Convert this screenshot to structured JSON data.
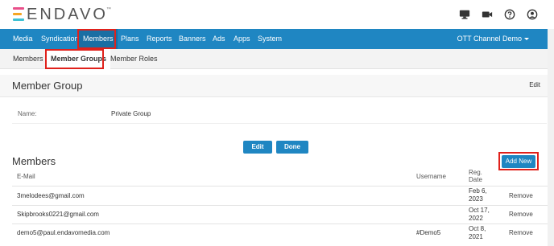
{
  "brand": {
    "name": "ENDAVO",
    "tm": "™"
  },
  "header_icons": [
    "monitor-icon",
    "video-camera-icon",
    "help-icon",
    "user-account-icon"
  ],
  "nav": {
    "items": [
      "Media",
      "Syndication",
      "Members",
      "Plans",
      "Reports",
      "Banners",
      "Ads",
      "Apps",
      "System"
    ],
    "active": "Members",
    "channel": "OTT Channel Demo"
  },
  "subnav": {
    "items": [
      "Members",
      "Member Groups",
      "Member Roles"
    ],
    "active": "Member Groups"
  },
  "group": {
    "title": "Member Group",
    "edit_label": "Edit",
    "name_label": "Name:",
    "name_value": "Private Group",
    "edit_button": "Edit",
    "done_button": "Done"
  },
  "members": {
    "title": "Members",
    "add_new": "Add New",
    "columns": {
      "email": "E-Mail",
      "username": "Username",
      "reg_date_1": "Reg.",
      "reg_date_2": "Date"
    },
    "rows": [
      {
        "email": "3melodees@gmail.com",
        "username": "",
        "date_1": "Feb 6,",
        "date_2": "2023",
        "action": "Remove"
      },
      {
        "email": "Skipbrooks0221@gmail.com",
        "username": "",
        "date_1": "Oct 17,",
        "date_2": "2022",
        "action": "Remove"
      },
      {
        "email": "demo5@paul.endavomedia.com",
        "username": "#Demo5",
        "date_1": "Oct 8,",
        "date_2": "2021",
        "action": "Remove"
      }
    ]
  },
  "colors": {
    "primary": "#1f86c2",
    "highlight": "#e0211b"
  }
}
